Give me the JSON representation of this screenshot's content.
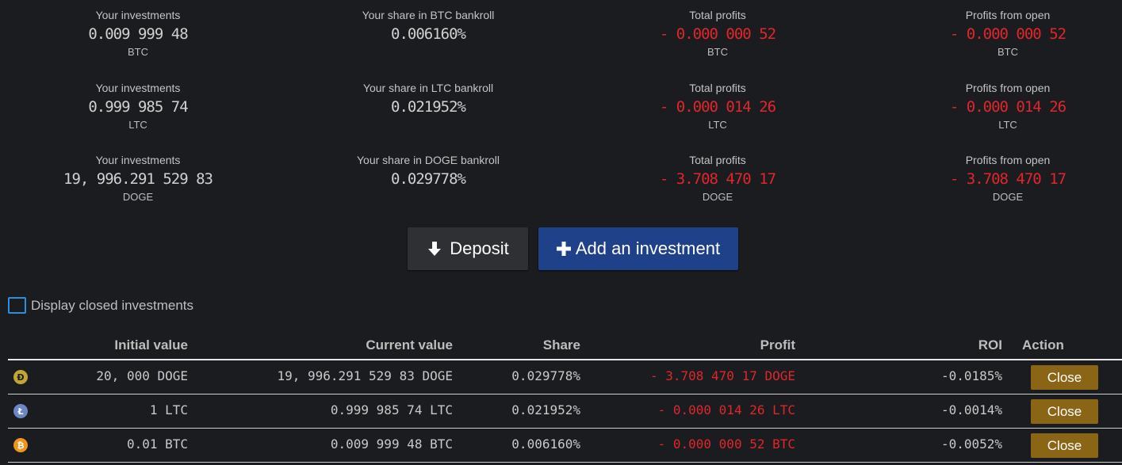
{
  "stats": {
    "btc": {
      "investments_label": "Your investments",
      "investments_value": "0.009 999 48",
      "investments_cur": "BTC",
      "share_label": "Your share in BTC bankroll",
      "share_value": "0.006160%",
      "profits_label": "Total profits",
      "profits_value": "- 0.000 000 52",
      "profits_cur": "BTC",
      "open_label": "Profits from open",
      "open_value": "- 0.000 000 52",
      "open_cur": "BTC"
    },
    "ltc": {
      "investments_label": "Your investments",
      "investments_value": "0.999 985 74",
      "investments_cur": "LTC",
      "share_label": "Your share in LTC bankroll",
      "share_value": "0.021952%",
      "profits_label": "Total profits",
      "profits_value": "- 0.000 014 26",
      "profits_cur": "LTC",
      "open_label": "Profits from open",
      "open_value": "- 0.000 014 26",
      "open_cur": "LTC"
    },
    "doge": {
      "investments_label": "Your investments",
      "investments_value": "19, 996.291 529 83",
      "investments_cur": "DOGE",
      "share_label": "Your share in DOGE bankroll",
      "share_value": "0.029778%",
      "profits_label": "Total profits",
      "profits_value": "- 3.708 470 17",
      "profits_cur": "DOGE",
      "open_label": "Profits from open",
      "open_value": "- 3.708 470 17",
      "open_cur": "DOGE"
    }
  },
  "buttons": {
    "deposit_label": "Deposit",
    "add_label": "Add an investment"
  },
  "filter": {
    "display_closed_label": "Display closed investments"
  },
  "table": {
    "headers": {
      "initial": "Initial value",
      "current": "Current value",
      "share": "Share",
      "profit": "Profit",
      "roi": "ROI",
      "action": "Action"
    },
    "rows": [
      {
        "coin": "doge",
        "coin_glyph": "Ð",
        "initial": "20, 000 DOGE",
        "current": "19, 996.291 529 83 DOGE",
        "share": "0.029778%",
        "profit": "- 3.708 470 17 DOGE",
        "roi": "-0.0185%",
        "action": "Close"
      },
      {
        "coin": "ltc",
        "coin_glyph": "Ł",
        "initial": "1 LTC",
        "current": "0.999 985 74 LTC",
        "share": "0.021952%",
        "profit": "- 0.000 014 26 LTC",
        "roi": "-0.0014%",
        "action": "Close"
      },
      {
        "coin": "btc",
        "coin_glyph": "₿",
        "initial": "0.01 BTC",
        "current": "0.009 999 48 BTC",
        "share": "0.006160%",
        "profit": "- 0.000 000 52 BTC",
        "roi": "-0.0052%",
        "action": "Close"
      }
    ]
  },
  "colors": {
    "background": "#1b1c1f",
    "negative": "#e0262b",
    "deposit_button": "#2f3033",
    "add_button": "#1f418a",
    "close_button": "#8a6516",
    "checkbox_border": "#2d8ee0"
  }
}
